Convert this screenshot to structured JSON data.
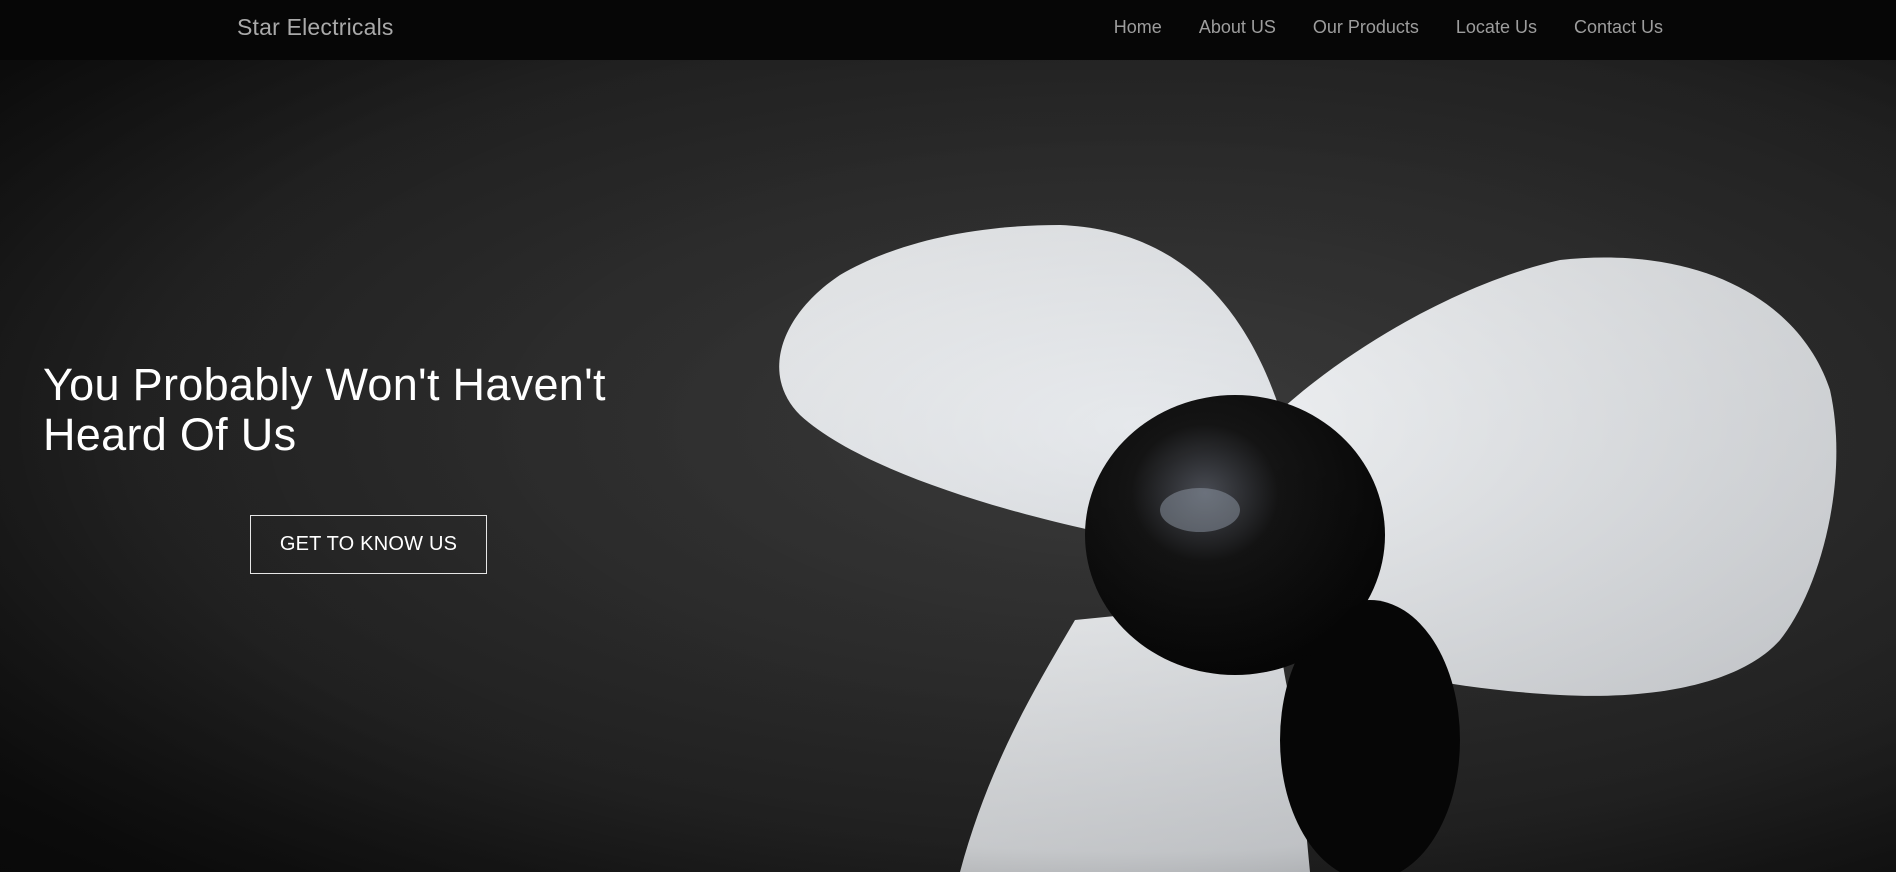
{
  "navbar": {
    "brand": "Star Electricals",
    "links": [
      {
        "label": "Home"
      },
      {
        "label": "About US"
      },
      {
        "label": "Our Products"
      },
      {
        "label": "Locate Us"
      },
      {
        "label": "Contact Us"
      }
    ]
  },
  "hero": {
    "heading_line1": "You Probably Won't Haven't",
    "heading_line2": "Heard Of Us",
    "cta_label": "GET TO KNOW US",
    "image_subject": "fan-blades-photo"
  },
  "colors": {
    "navbar_bg": "#060606",
    "nav_text": "#9d9d9d",
    "hero_bg": "#2f2f2f",
    "blade": "#e9ecef",
    "hub": "#0b0b0b"
  }
}
